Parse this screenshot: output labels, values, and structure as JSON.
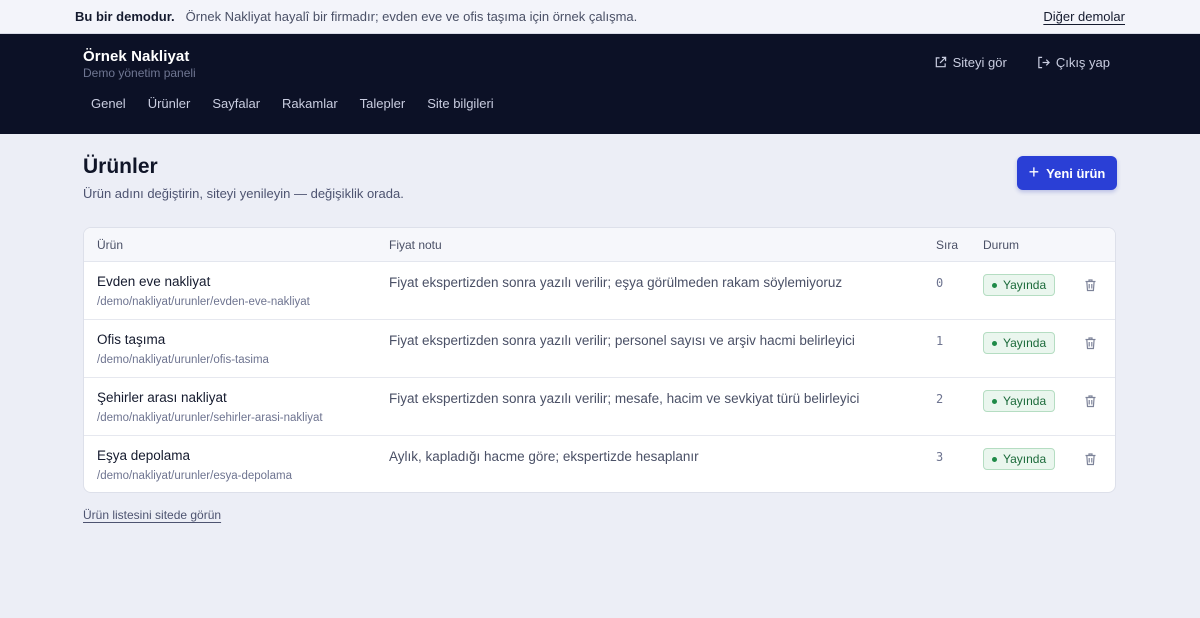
{
  "demo_bar": {
    "strong": "Bu bir demodur.",
    "text": "Örnek Nakliyat hayalî bir firmadır; evden eve ve ofis taşıma için örnek çalışma.",
    "link": "Diğer demolar"
  },
  "header": {
    "title": "Örnek Nakliyat",
    "subtitle": "Demo yönetim paneli",
    "actions": {
      "view_site": "Siteyi gör",
      "logout": "Çıkış yap"
    },
    "nav": [
      "Genel",
      "Ürünler",
      "Sayfalar",
      "Rakamlar",
      "Talepler",
      "Site bilgileri"
    ]
  },
  "page": {
    "title": "Ürünler",
    "subtitle": "Ürün adını değiştirin, siteyi yenileyin — değişiklik orada.",
    "new_button": "Yeni ürün"
  },
  "table": {
    "columns": {
      "product": "Ürün",
      "price_note": "Fiyat notu",
      "order": "Sıra",
      "status": "Durum"
    },
    "rows": [
      {
        "name": "Evden eve nakliyat",
        "slug": "/demo/nakliyat/urunler/evden-eve-nakliyat",
        "note": "Fiyat ekspertizden sonra yazılı verilir; eşya görülmeden rakam söylemiyoruz",
        "order": "0",
        "status": "Yayında"
      },
      {
        "name": "Ofis taşıma",
        "slug": "/demo/nakliyat/urunler/ofis-tasima",
        "note": "Fiyat ekspertizden sonra yazılı verilir; personel sayısı ve arşiv hacmi belirleyici",
        "order": "1",
        "status": "Yayında"
      },
      {
        "name": "Şehirler arası nakliyat",
        "slug": "/demo/nakliyat/urunler/sehirler-arasi-nakliyat",
        "note": "Fiyat ekspertizden sonra yazılı verilir; mesafe, hacim ve sevkiyat türü belirleyici",
        "order": "2",
        "status": "Yayında"
      },
      {
        "name": "Eşya depolama",
        "slug": "/demo/nakliyat/urunler/esya-depolama",
        "note": "Aylık, kapladığı hacme göre; ekspertizde hesaplanır",
        "order": "3",
        "status": "Yayında"
      }
    ]
  },
  "footer_link": "Ürün listesini sitede görün",
  "colors": {
    "header_bg": "#0c1126",
    "accent": "#2a3fd6",
    "status_green": "#1f8a48",
    "page_bg": "#eceef6"
  },
  "icons": {
    "view_site": "external-link-icon",
    "logout": "logout-icon",
    "new": "plus-icon",
    "delete": "trash-icon",
    "status": "status-dot-icon"
  }
}
